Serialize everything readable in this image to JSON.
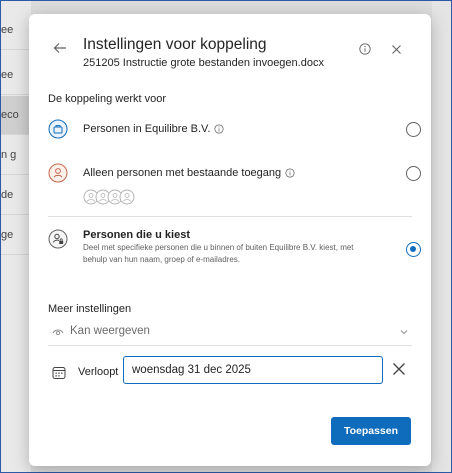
{
  "background_rows": [
    "ee",
    "ee",
    "eco",
    "n g",
    "de",
    "ge"
  ],
  "dialog": {
    "title": "Instellingen voor koppeling",
    "subtitle": "251205 Instructie grote bestanden invoegen.docx",
    "section_label": "De koppeling werkt voor",
    "options": [
      {
        "label": "Personen in Equilibre B.V.",
        "icon": "briefcase-icon",
        "selected": false
      },
      {
        "label": "Alleen personen met bestaande toegang",
        "icon": "person-icon",
        "selected": false
      },
      {
        "label": "Personen die u kiest",
        "description": "Deel met specifieke personen die u binnen of buiten Equilibre B.V. kiest, met behulp van hun naam, groep of e-mailadres.",
        "icon": "people-lock-icon",
        "selected": true
      }
    ],
    "more_settings_label": "Meer instellingen",
    "permission": {
      "label": "Kan weergeven",
      "icon": "eye-icon"
    },
    "expiry": {
      "label": "Verloopt",
      "value": "woensdag 31 dec 2025",
      "icon": "calendar-icon"
    },
    "apply_label": "Toepassen"
  },
  "colors": {
    "accent": "#0f6cbd",
    "text": "#242424",
    "muted": "#616161"
  }
}
